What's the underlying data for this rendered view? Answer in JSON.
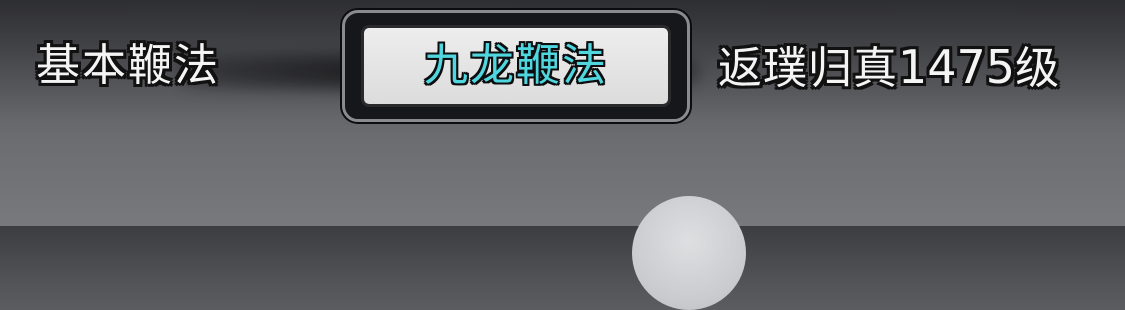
{
  "martial_skills": {
    "left_label": "基本鞭法",
    "selected_tab_label": "九龙鞭法",
    "right_realm": "返璞归真",
    "right_level_number": "1475",
    "right_level_unit": "级"
  },
  "colors": {
    "selected_text": "#4fd6de",
    "plain_text": "#f4f4f4",
    "outline": "#111111"
  }
}
